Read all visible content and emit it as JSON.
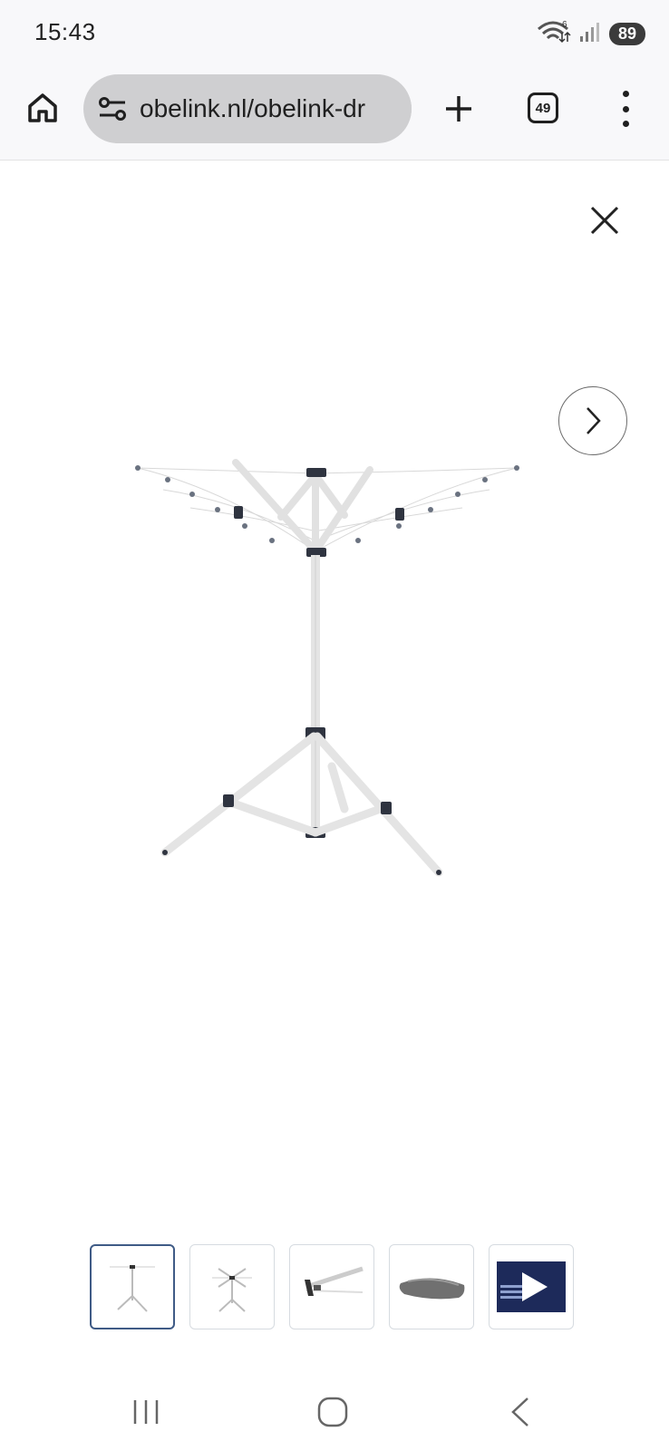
{
  "status_bar": {
    "time": "15:43",
    "wifi_badge": "6",
    "battery": "89"
  },
  "browser": {
    "url": "obelink.nl/obelink-dr",
    "tab_count": "49",
    "icons": {
      "home": "home-icon",
      "site_settings": "tune-icon",
      "new_tab": "plus-icon",
      "tabs": "tab-switcher-icon",
      "menu": "more-vert-icon"
    }
  },
  "viewer": {
    "close_icon": "close-icon",
    "next_icon": "chevron-right-icon",
    "main_image": "rotary-clothes-dryer-image",
    "thumbnails": [
      {
        "name": "thumb-dryer-front",
        "active": true
      },
      {
        "name": "thumb-dryer-angle",
        "active": false
      },
      {
        "name": "thumb-dryer-folded",
        "active": false
      },
      {
        "name": "thumb-carry-bag",
        "active": false
      },
      {
        "name": "thumb-video",
        "active": false
      }
    ]
  },
  "system_nav": {
    "recents": "recents-icon",
    "home": "home-circle-icon",
    "back": "back-icon"
  },
  "colors": {
    "toolbar_bg": "#f8f8fa",
    "urlbar_bg": "#cfcfd1",
    "thumb_active_border": "#3f5b86"
  }
}
